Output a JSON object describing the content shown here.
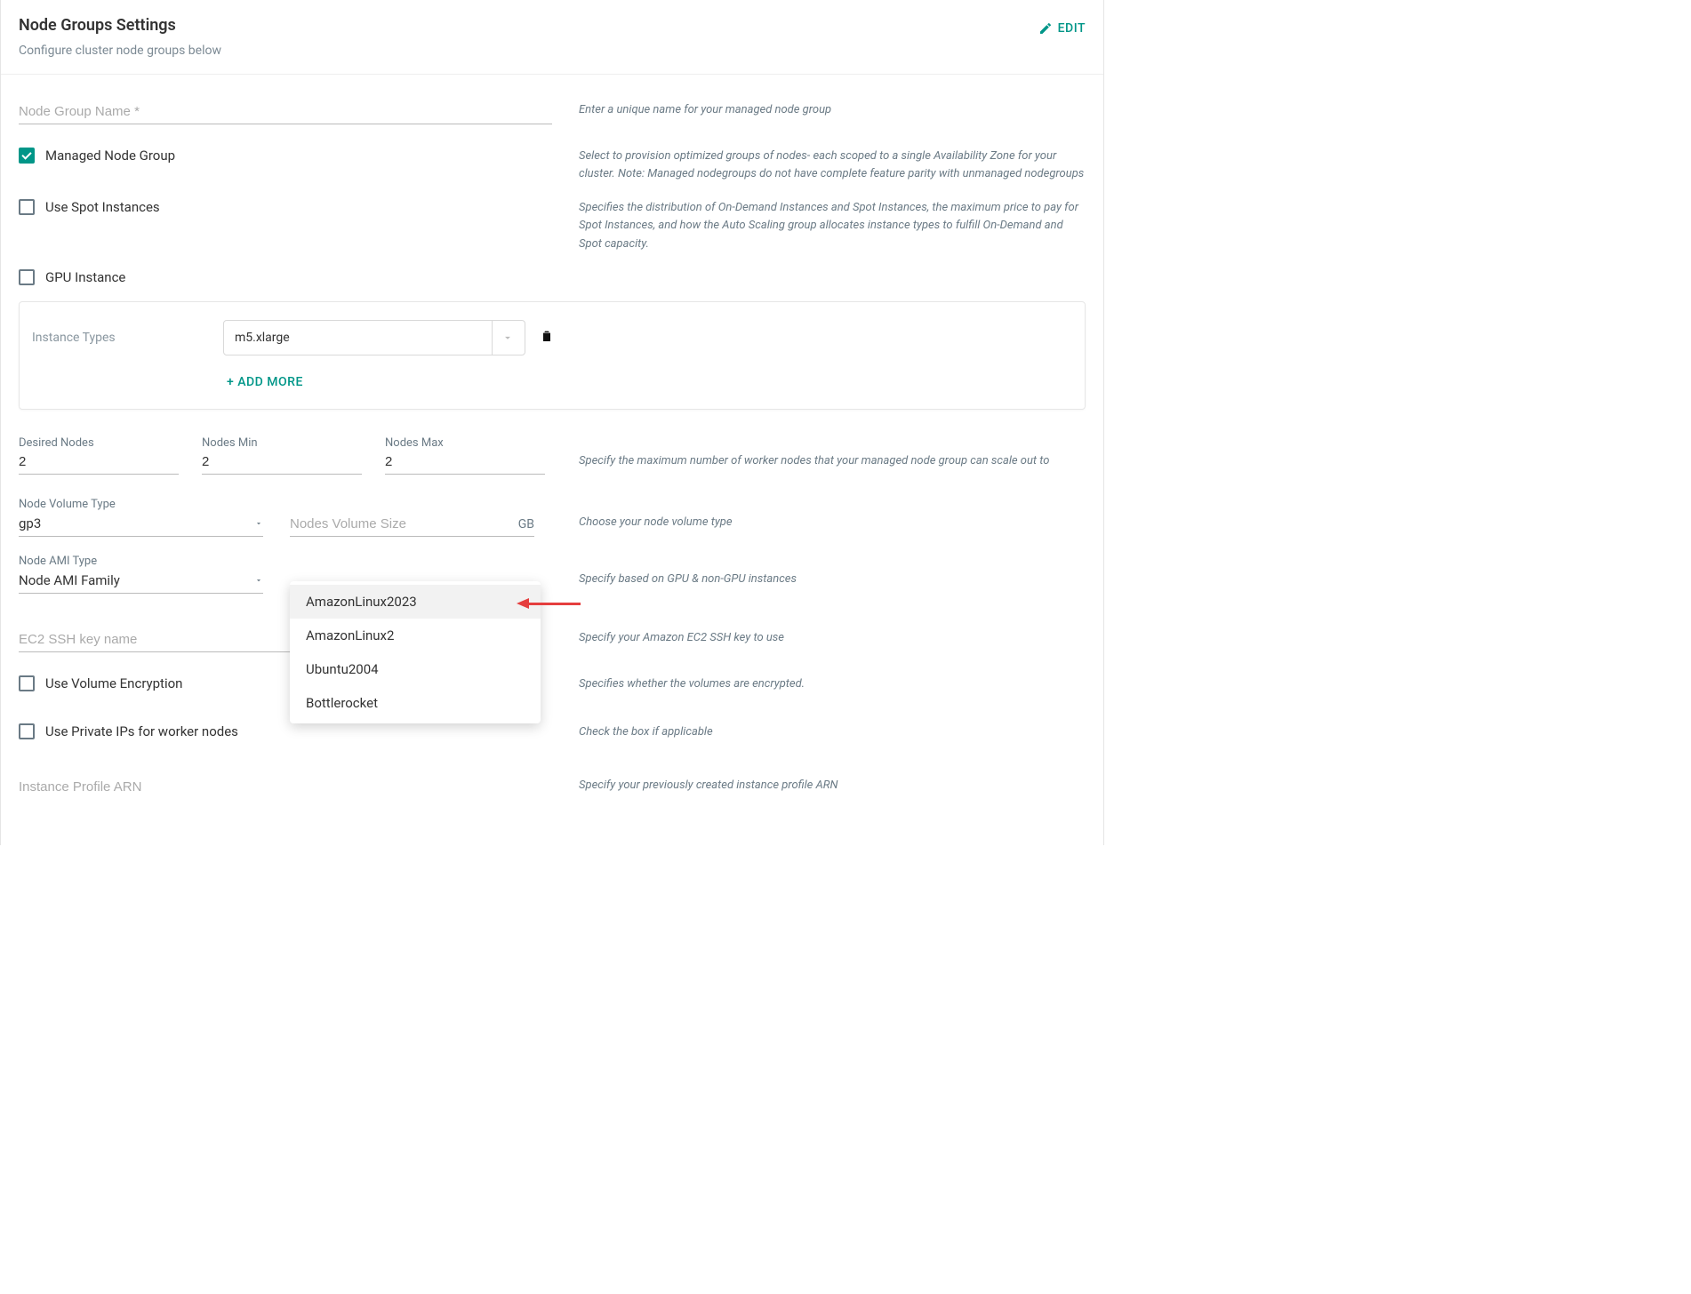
{
  "header": {
    "title": "Node Groups Settings",
    "subtitle": "Configure cluster node groups below",
    "edit_label": "EDIT"
  },
  "ngName": {
    "label": "Node Group Name *",
    "value": "",
    "hint": "Enter a unique name for your managed node group"
  },
  "managed": {
    "label": "Managed Node Group",
    "checked": true,
    "hint": "Select to provision optimized groups of nodes- each scoped to a single Availability Zone for your cluster. Note: Managed nodegroups do not have complete feature parity with unmanaged nodegroups"
  },
  "spot": {
    "label": "Use Spot Instances",
    "checked": false,
    "hint": "Specifies the distribution of On-Demand Instances and Spot Instances, the maximum price to pay for Spot Instances, and how the Auto Scaling group allocates instance types to fulfill On-Demand and Spot capacity."
  },
  "gpu": {
    "label": "GPU Instance",
    "checked": false
  },
  "instance": {
    "label": "Instance Types",
    "value": "m5.xlarge",
    "add_more": "+ ADD MORE"
  },
  "nodes": {
    "desired_label": "Desired Nodes",
    "min_label": "Nodes Min",
    "max_label": "Nodes Max",
    "desired": "2",
    "min": "2",
    "max": "2",
    "hint": "Specify the maximum number of worker nodes that your managed node group can scale out to"
  },
  "vol": {
    "type_label": "Node Volume Type",
    "type_value": "gp3",
    "size_label": "Nodes Volume Size",
    "size_value": "",
    "size_unit": "GB",
    "hint": "Choose your node volume type"
  },
  "ami": {
    "label": "Node AMI Type",
    "value": "Node AMI Family",
    "hint": "Specify based on GPU & non-GPU instances",
    "options": [
      "AmazonLinux2023",
      "AmazonLinux2",
      "Ubuntu2004",
      "Bottlerocket"
    ]
  },
  "ssh": {
    "label": "EC2 SSH key name",
    "value": "",
    "hint": "Specify your Amazon EC2 SSH key to use"
  },
  "volEnc": {
    "label": "Use Volume Encryption",
    "checked": false,
    "hint": "Specifies whether the volumes are encrypted."
  },
  "privIp": {
    "label": "Use Private IPs for worker nodes",
    "checked": false,
    "hint": "Check the box if applicable"
  },
  "profArn": {
    "label": "Instance Profile ARN",
    "value": "",
    "hint": "Specify your previously created instance profile ARN"
  }
}
